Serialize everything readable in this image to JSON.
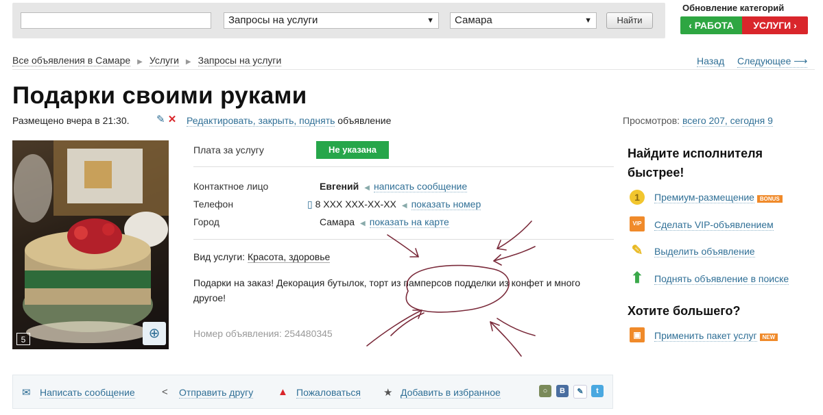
{
  "search": {
    "query_placeholder": "",
    "category_value": "Запросы на услуги",
    "city_value": "Самара",
    "submit_label": "Найти"
  },
  "category_update": {
    "title": "Обновление категорий",
    "work_label": "‹ РАБОТА",
    "services_label": "УСЛУГИ ›"
  },
  "breadcrumb": [
    "Все объявления в Самаре",
    "Услуги",
    "Запросы на услуги"
  ],
  "nav": {
    "back": "Назад",
    "next": "Следующее ⟶"
  },
  "ad": {
    "title": "Подарки своими руками",
    "posted": "Размещено вчера в 21:30.",
    "edit_links": "Редактировать, закрыть, поднять",
    "edit_suffix": "объявление",
    "views_label": "Просмотров:",
    "views_value": "всего 207, сегодня 9",
    "photo_count": "5",
    "price_label": "Плата за услугу",
    "price_value": "Не указана",
    "contact_label": "Контактное лицо",
    "contact_name": "Евгений",
    "contact_action": "написать сообщение",
    "phone_label": "Телефон",
    "phone_value": "8 XXX XXX-XX-XX",
    "phone_action": "показать номер",
    "city_label": "Город",
    "city_value": "Самара",
    "city_action": "показать на карте",
    "service_type_label": "Вид услуги:",
    "service_type_value": "Красота, здоровье",
    "description": "Подарки на заказ! Декорация бутылок, торт из памперсов подделки из конфет и много другое!",
    "ad_number": "Номер объявления: 254480345"
  },
  "promo": {
    "title": "Найдите исполнителя быстрее!",
    "items": [
      {
        "label": "Премиум-размещение",
        "tag": "BONUS",
        "icon": "coin-icon"
      },
      {
        "label": "Сделать VIP-объявлением",
        "icon": "vip-icon"
      },
      {
        "label": "Выделить объявление",
        "icon": "highlighter-icon"
      },
      {
        "label": "Поднять объявление в поиске",
        "icon": "arrow-up-icon"
      }
    ],
    "more_title": "Хотите большего?",
    "package_label": "Применить пакет услуг",
    "package_tag": "NEW"
  },
  "actions": {
    "message": "Написать сообщение",
    "share": "Отправить другу",
    "report": "Пожаловаться",
    "favorite": "Добавить в избранное"
  },
  "colors": {
    "link": "#2f6f96",
    "work_green": "#2ea642",
    "services_red": "#d9262b",
    "price_green": "#26a64a"
  }
}
